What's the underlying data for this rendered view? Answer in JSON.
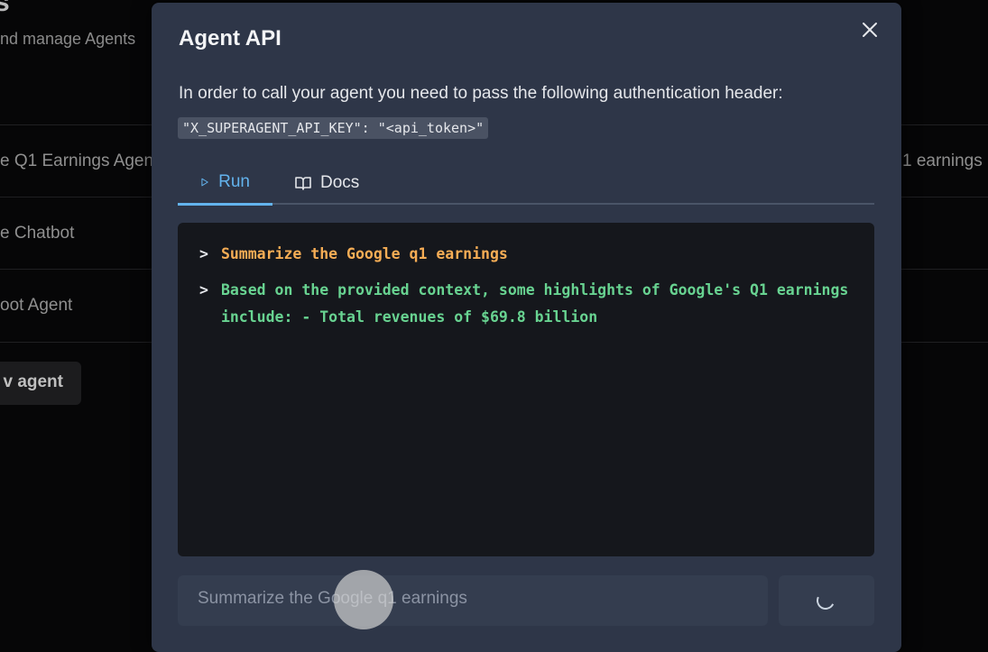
{
  "background": {
    "title": "s",
    "subtitle": "nd manage Agents",
    "rows": [
      "e Q1 Earnings Agent",
      "e Chatbot",
      "oot Agent"
    ],
    "new_agent_button": "v agent",
    "right_text": "1 earnings"
  },
  "modal": {
    "title": "Agent API",
    "description": "In order to call your agent you need to pass the following authentication header:",
    "code": "\"X_SUPERAGENT_API_KEY\": \"<api_token>\"",
    "tabs": [
      {
        "label": "Run",
        "icon": "play-icon",
        "active": true
      },
      {
        "label": "Docs",
        "icon": "book-icon",
        "active": false
      }
    ],
    "terminal": {
      "prompt_symbol": ">",
      "question": "Summarize the Google q1 earnings",
      "answer": "Based on the provided context, some highlights of Google's Q1 earnings include: - Total revenues of $69.8 billion"
    },
    "input_value": "Summarize the Google q1 earnings",
    "send_state": "loading-spinner-icon"
  },
  "colors": {
    "accent": "#63b3ed",
    "question": "#f6ad55",
    "answer": "#68d391",
    "modal_bg": "#2e3648"
  }
}
